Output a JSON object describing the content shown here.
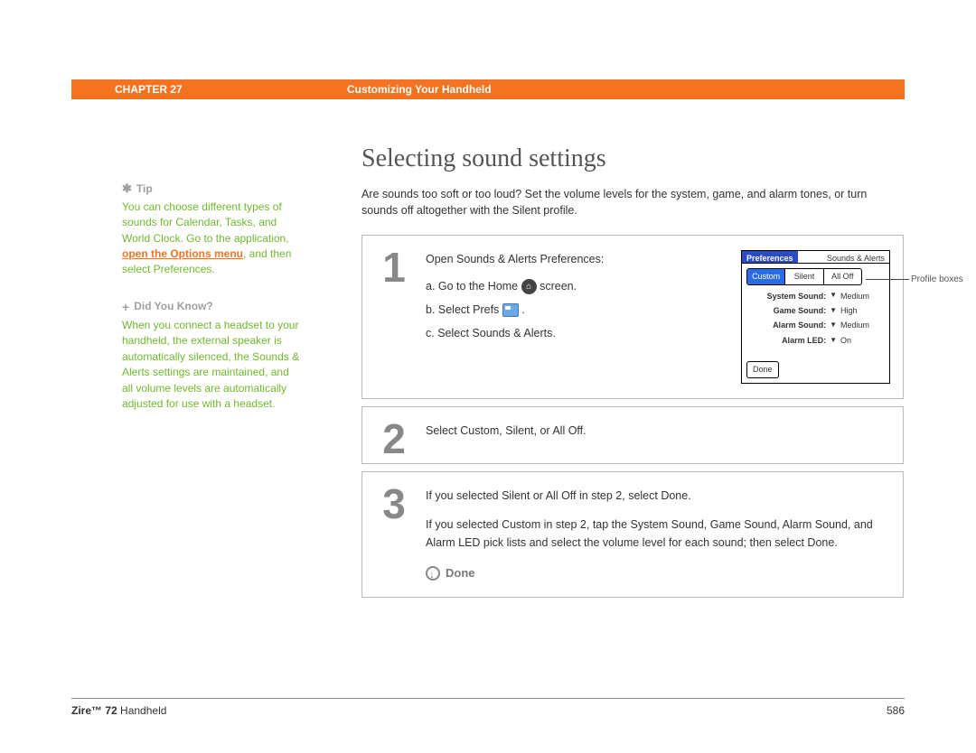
{
  "header": {
    "chapter": "CHAPTER 27",
    "title": "Customizing Your Handheld"
  },
  "sidebar": {
    "tip": {
      "label": "Tip",
      "text_before": "You can choose different types of sounds for Calendar, Tasks, and World Clock. Go to the application, ",
      "link": "open the Options menu",
      "text_after": ", and then select Preferences."
    },
    "dyk": {
      "label": "Did You Know?",
      "text": "When you connect a headset to your handheld, the external speaker is automatically silenced, the Sounds & Alerts settings are maintained, and all volume levels are automatically adjusted for use with a headset."
    }
  },
  "main": {
    "heading": "Selecting sound settings",
    "intro": "Are sounds too soft or too loud? Set the volume levels for the system, game, and alarm tones, or turn sounds off altogether with the Silent profile.",
    "steps": {
      "s1": {
        "num": "1",
        "lead": "Open Sounds & Alerts Preferences:",
        "a_pre": "a.  Go to the Home ",
        "a_post": " screen.",
        "b_pre": "b.  Select Prefs ",
        "b_post": " .",
        "c": "c.  Select Sounds & Alerts."
      },
      "s2": {
        "num": "2",
        "text": "Select Custom, Silent, or All Off."
      },
      "s3": {
        "num": "3",
        "p1": "If you selected Silent or All Off in step 2, select Done.",
        "p2": "If you selected Custom in step 2, tap the System Sound, Game Sound, Alarm Sound, and Alarm LED pick lists and select the volume level for each sound; then select Done.",
        "done": "Done"
      }
    },
    "pref": {
      "title_left": "Preferences",
      "title_right": "Sounds & Alerts",
      "tabs": [
        "Custom",
        "Silent",
        "All Off"
      ],
      "rows": [
        {
          "label": "System Sound:",
          "value": "Medium"
        },
        {
          "label": "Game Sound:",
          "value": "High"
        },
        {
          "label": "Alarm Sound:",
          "value": "Medium"
        },
        {
          "label": "Alarm LED:",
          "value": "On"
        }
      ],
      "done": "Done",
      "callout": "Profile boxes"
    }
  },
  "footer": {
    "product_bold": "Zire™ 72",
    "product_rest": " Handheld",
    "page": "586"
  }
}
